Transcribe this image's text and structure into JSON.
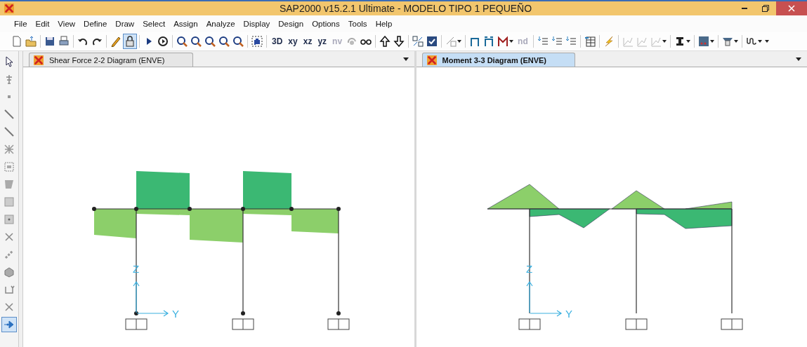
{
  "window": {
    "title": "SAP2000 v15.2.1 Ultimate  - MODELO TIPO 1 PEQUEÑO"
  },
  "menu": [
    "File",
    "Edit",
    "View",
    "Define",
    "Draw",
    "Select",
    "Assign",
    "Analyze",
    "Display",
    "Design",
    "Options",
    "Tools",
    "Help"
  ],
  "toolbar": [
    {
      "kind": "icon",
      "selected": false
    },
    {
      "kind": "icon",
      "selected": false
    },
    {
      "kind": "separator"
    },
    {
      "kind": "icon",
      "selected": false
    },
    {
      "kind": "icon",
      "selected": false
    },
    {
      "kind": "separator"
    },
    {
      "kind": "icon",
      "selected": false
    },
    {
      "kind": "icon",
      "selected": false
    },
    {
      "kind": "separator"
    },
    {
      "kind": "icon",
      "selected": false
    },
    {
      "kind": "icon",
      "selected": true
    },
    {
      "kind": "separator"
    },
    {
      "kind": "icon",
      "selected": false
    },
    {
      "kind": "icon",
      "selected": false
    },
    {
      "kind": "separator"
    },
    {
      "kind": "icon",
      "selected": false
    },
    {
      "kind": "icon",
      "selected": false
    },
    {
      "kind": "icon",
      "selected": false
    },
    {
      "kind": "icon",
      "selected": false
    },
    {
      "kind": "icon",
      "selected": false
    },
    {
      "kind": "separator"
    },
    {
      "kind": "icon",
      "selected": false
    },
    {
      "kind": "separator"
    },
    {
      "kind": "text",
      "label": "3D",
      "disabled": false,
      "selected": false
    },
    {
      "kind": "text",
      "label": "xy",
      "disabled": false,
      "selected": false
    },
    {
      "kind": "text",
      "label": "xz",
      "disabled": false,
      "selected": false
    },
    {
      "kind": "text",
      "label": "yz",
      "disabled": false,
      "selected": false
    },
    {
      "kind": "text",
      "label": "nv",
      "disabled": true,
      "selected": false
    },
    {
      "kind": "icon",
      "selected": false
    },
    {
      "kind": "icon",
      "selected": false
    },
    {
      "kind": "separator"
    },
    {
      "kind": "icon",
      "selected": false
    },
    {
      "kind": "icon",
      "selected": false
    },
    {
      "kind": "separator"
    },
    {
      "kind": "icon",
      "selected": false
    },
    {
      "kind": "icon",
      "selected": false
    },
    {
      "kind": "separator"
    },
    {
      "kind": "dropdown",
      "selected": false
    },
    {
      "kind": "separator"
    },
    {
      "kind": "icon",
      "selected": false
    },
    {
      "kind": "icon",
      "selected": false
    },
    {
      "kind": "dropdown",
      "selected": false
    },
    {
      "kind": "text",
      "label": "nd",
      "disabled": true,
      "selected": false
    },
    {
      "kind": "separator"
    },
    {
      "kind": "icon",
      "selected": false
    },
    {
      "kind": "icon",
      "selected": false
    },
    {
      "kind": "icon",
      "selected": false
    },
    {
      "kind": "separator"
    },
    {
      "kind": "icon",
      "selected": false
    },
    {
      "kind": "separator"
    },
    {
      "kind": "icon",
      "selected": false
    },
    {
      "kind": "separator"
    },
    {
      "kind": "icon",
      "selected": false
    },
    {
      "kind": "icon",
      "selected": false
    },
    {
      "kind": "dropdown",
      "selected": false
    },
    {
      "kind": "separator"
    },
    {
      "kind": "dropdown",
      "selected": false
    },
    {
      "kind": "separator"
    },
    {
      "kind": "dropdown",
      "selected": false
    },
    {
      "kind": "separator"
    },
    {
      "kind": "dropdown",
      "selected": false
    },
    {
      "kind": "separator"
    },
    {
      "kind": "dropdown",
      "selected": false
    },
    {
      "kind": "caret",
      "selected": false
    }
  ],
  "side_toolbar": [
    {
      "selected": false
    },
    {
      "selected": false
    },
    {
      "selected": false
    },
    {
      "selected": false
    },
    {
      "selected": false
    },
    {
      "selected": false
    },
    {
      "selected": false
    },
    {
      "selected": false
    },
    {
      "selected": false
    },
    {
      "selected": false
    },
    {
      "selected": false
    },
    {
      "selected": false
    },
    {
      "selected": false
    },
    {
      "selected": false
    },
    {
      "selected": false
    },
    {
      "selected": true
    }
  ],
  "panes": [
    {
      "kind": "shear",
      "tab": {
        "label": "Shear Force 2-2 Diagram  (ENVE)",
        "selected": false
      },
      "axes": {
        "vertical": "Z",
        "horizontal": "Y"
      }
    },
    {
      "kind": "moment",
      "tab": {
        "label": "Moment 3-3 Diagram  (ENVE)",
        "selected": true
      },
      "axes": {
        "vertical": "Z",
        "horizontal": "Y"
      }
    }
  ]
}
